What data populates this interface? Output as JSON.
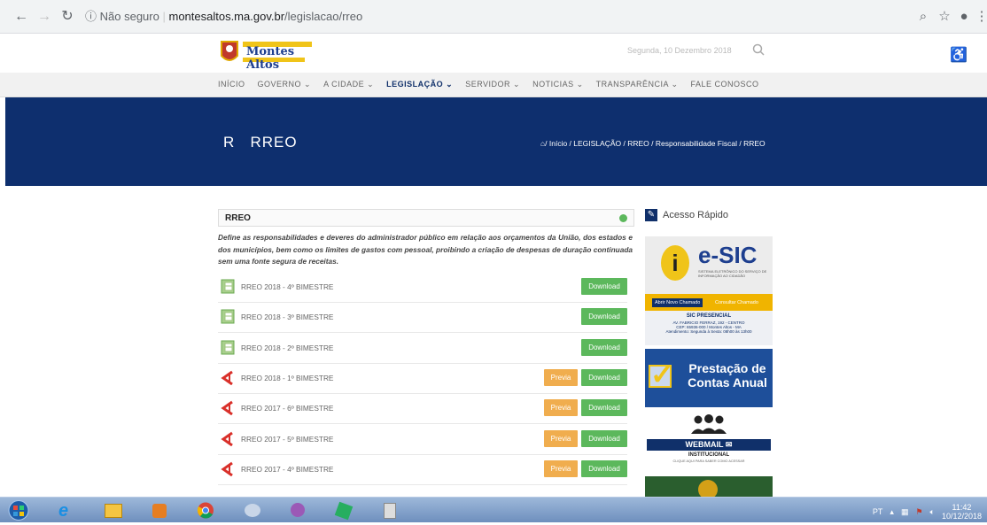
{
  "browser": {
    "security": "Não seguro",
    "domain": "montesaltos.ma.gov.br",
    "path": "/legislacao/rreo"
  },
  "site": {
    "logo": "Montes Altos",
    "date": "Segunda, 10 Dezembro 2018",
    "menu": [
      "INÍCIO",
      "GOVERNO ⌄",
      "A CIDADE ⌄",
      "LEGISLAÇÃO ⌄",
      "SERVIDOR ⌄",
      "NOTICIAS ⌄",
      "TRANSPARÊNCIA ⌄",
      "FALE CONOSCO"
    ],
    "active_menu": "LEGISLAÇÃO ⌄",
    "brand_color": "#0e2f6e",
    "page_title_letter": "R",
    "page_title": "RREO",
    "breadcrumb": "/ Início / LEGISLAÇÃO / RREO / Responsabilidade Fiscal / RREO"
  },
  "rreo": {
    "heading": "RREO",
    "description": "Define as responsabilidades e deveres do administrador público em relação aos orçamentos da União, dos estados e dos municípios, bem como os limites de gastos com pessoal, proibindo a criação de despesas de duração continuada sem uma fonte segura de receitas.",
    "download_label": "Download",
    "preview_label": "Previa",
    "items": [
      {
        "label": "RREO 2018 - 4º BIMESTRE",
        "icon": "excel-icon",
        "preview": false
      },
      {
        "label": "RREO 2018 - 3º BIMESTRE",
        "icon": "excel-icon",
        "preview": false
      },
      {
        "label": "RREO 2018 - 2º BIMESTRE",
        "icon": "excel-icon",
        "preview": false
      },
      {
        "label": "RREO 2018 - 1º BIMESTRE",
        "icon": "pdf-icon",
        "preview": true
      },
      {
        "label": "RREO 2017 - 6º BIMESTRE",
        "icon": "pdf-icon",
        "preview": true
      },
      {
        "label": "RREO 2017 - 5º BIMESTRE",
        "icon": "pdf-icon",
        "preview": true
      },
      {
        "label": "RREO 2017 - 4º BIMESTRE",
        "icon": "pdf-icon",
        "preview": true
      }
    ]
  },
  "sidebar": {
    "title": "Acesso Rápido",
    "esic": {
      "brand": "e-SIC",
      "subtitle": "SISTEMA ELETRÔNICO DO SERVIÇO DE INFORMAÇÃO AO CIDADÃO",
      "btn_new": "Abrir Novo Chamado",
      "btn_check": "Consultar Chamado",
      "presencial": "SIC PRESENCIAL",
      "address": "AV. FABRICIO FERRAZ, 192 - CENTRO",
      "cep": "CEP: 65936-000 / Montes Altos - MA",
      "hours": "Atendimento: Segunda à Sexta: 08h00 às 13h00"
    },
    "prestacao": "Prestação de Contas Anual",
    "webmail": "WEBMAIL",
    "webmail_sub": "INSTITUCIONAL",
    "webmail_note": "CLIQUE AQUI PARA SABER COMO ACESSAR"
  },
  "taskbar": {
    "lang": "PT",
    "time": "11:42",
    "date": "10/12/2018"
  }
}
